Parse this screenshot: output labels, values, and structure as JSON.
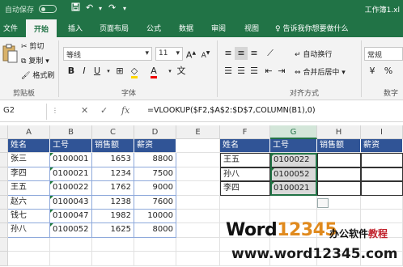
{
  "titlebar": {
    "autosave": "自动保存",
    "autosave_state": "off",
    "doc_title": "工作簿1.xl"
  },
  "tabs": [
    "文件",
    "开始",
    "插入",
    "页面布局",
    "公式",
    "数据",
    "审阅",
    "视图"
  ],
  "active_tab": "开始",
  "tell_me": "告诉我你想要做什么",
  "ribbon": {
    "clipboard": {
      "cut": "剪切",
      "copy": "复制",
      "format_painter": "格式刷",
      "label": "剪贴板"
    },
    "font": {
      "name": "等线",
      "size": "11",
      "label": "字体"
    },
    "alignment": {
      "wrap": "自动换行",
      "merge": "合并后居中",
      "label": "对齐方式"
    },
    "number": {
      "format": "常规",
      "label": "数字"
    }
  },
  "formula_bar": {
    "namebox": "G2",
    "formula": "=VLOOKUP($F2,$A$2:$D$7,COLUMN(B1),0)"
  },
  "columns": [
    "A",
    "B",
    "C",
    "D",
    "E",
    "F",
    "G",
    "H",
    "I"
  ],
  "selected_column": "G",
  "table1": {
    "headers": [
      "姓名",
      "工号",
      "销售额",
      "薪资"
    ],
    "rows": [
      [
        "张三",
        "0100001",
        "1653",
        "8800"
      ],
      [
        "李四",
        "0100021",
        "1234",
        "7500"
      ],
      [
        "王五",
        "0100022",
        "1762",
        "9000"
      ],
      [
        "赵六",
        "0100043",
        "1238",
        "7600"
      ],
      [
        "钱七",
        "0100047",
        "1982",
        "10000"
      ],
      [
        "孙八",
        "0100052",
        "1625",
        "8000"
      ]
    ]
  },
  "table2": {
    "headers": [
      "姓名",
      "工号",
      "销售额",
      "薪资"
    ],
    "rows": [
      [
        "王五",
        "0100022",
        "",
        ""
      ],
      [
        "孙八",
        "0100052",
        "",
        ""
      ],
      [
        "李四",
        "0100021",
        "",
        ""
      ]
    ]
  },
  "watermark": {
    "word": "Word",
    "num": "12345",
    "cn_black": "办公软件",
    "cn_red": "教程",
    "url": "www.word12345.com"
  },
  "colors": {
    "excel_green": "#217346",
    "header_blue": "#305496"
  }
}
